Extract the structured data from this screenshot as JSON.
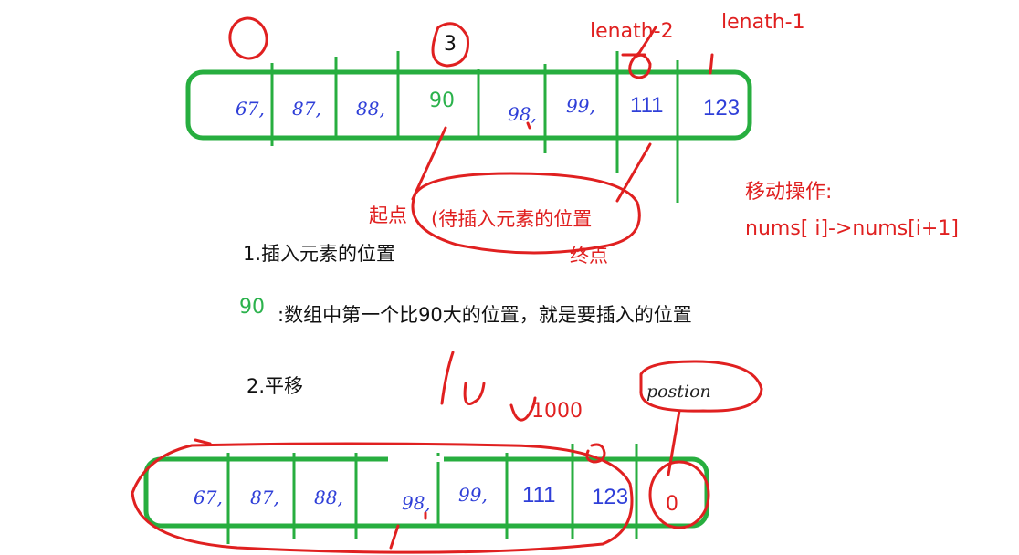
{
  "top_array": {
    "cells": [
      "67,",
      "87,",
      "88,",
      "90",
      "98,",
      "99,",
      "111",
      "123"
    ],
    "index_labels": {
      "zero": "0",
      "three": "3",
      "length_minus_2": "lenath-2",
      "length_minus_1": "lenath-1"
    }
  },
  "annotations": {
    "start_label": "起点",
    "waiting_position": "(待插入元素的位置",
    "end_label": "终点",
    "move_operation_title": "移动操作:",
    "move_operation_formula": "nums[ i]->nums[i+1]"
  },
  "steps": {
    "step1_title": "1.插入元素的位置",
    "green_value": "90",
    "step1_desc": ":数组中第一个比90大的位置，就是要插入的位置",
    "step2_title": "2.平移"
  },
  "bottom_array": {
    "cells": [
      "67,",
      "87,",
      "88,",
      "98,",
      "99,",
      "111",
      "123",
      "0"
    ],
    "position_label": "postion",
    "value_1000": "1000"
  },
  "colors": {
    "green_box": "#27ae3f",
    "red_ink": "#e02020",
    "blue_text": "#2f3fd8",
    "black_text": "#111111"
  }
}
